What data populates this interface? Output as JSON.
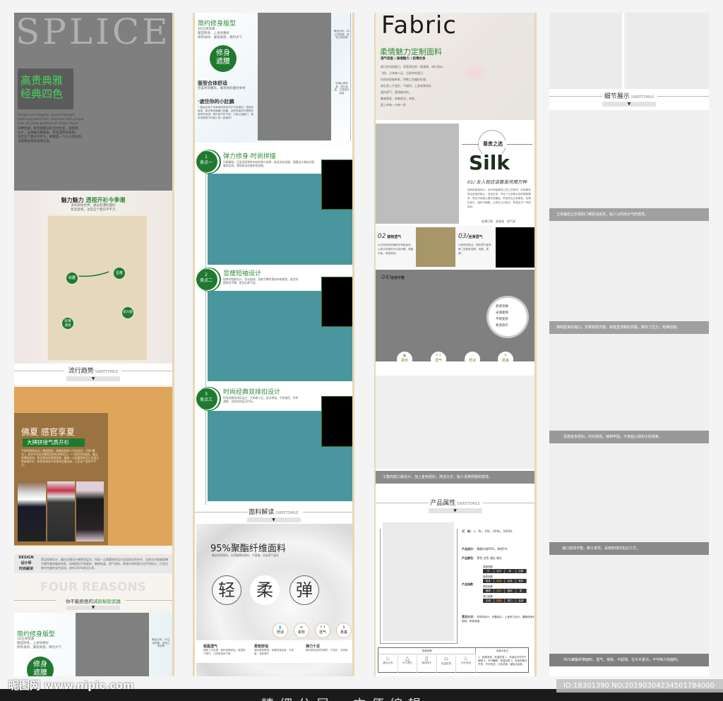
{
  "col1": {
    "splice": "SPLICE",
    "hero_title_1": "高贵典雅",
    "hero_title_2": "经典四色",
    "hero_en": "Simple and elegant, visual highlight charming waist line, decorate with proper size, all show goddess of urban charm",
    "hero_cn": [
      "四种色调，彰显着夏日的活力生机，透视感",
      "设计，呈现魅力腰部美，彰显成熟的美感。",
      "注定这个夏日不平凡，即使是一个小小的动作，",
      "也能看出她的美丽之处。"
    ],
    "charm_title_a": "魅力魅力",
    "charm_title_b": "透视开衫",
    "charm_title_c": "今季潮",
    "charm_sub": [
      "多彩缤纷世界，通过轻薄的面料",
      "彰显柔和，注定这个夏日不平凡"
    ],
    "badges": [
      "收腰",
      "显瘦",
      "遮大腿",
      "轻薄透视"
    ],
    "trend_title": "流行趋势",
    "sweetsmile": "SWEETSMILE",
    "summer_title": "佛夏 感官享夏",
    "summer_sub": "大牌拼接气质开衫",
    "summer_text": "今季时装周走出一袭透视装，随着轻松和人们的追求，不断“曝光”，成为今年夏季最受宠的时尚单品之一！四彩色的裙装，通过轻薄的面料，彰显柔和的透视效果，精选一点高腰线的设计呈夏日的轻柔外衫，彰显低调而不张扬的优雅品味，注定这个夏季不平凡。",
    "design_label": [
      "DESIGN",
      "设计师",
      "时尚解读"
    ],
    "design_text": "简洁短袖设计，露出优雅设计感更显层次，再加一点高腰线的设计呈现舒适的外衫，长款设计能够遮掩不够完美的腿部线条，高端面料手感柔软，触感轻盈、透气清凉，即使炎热的夏天也不用担心，打造出都市完美的女性身段，给你100%的回头率。",
    "four_reasons": "FOUR REASONS",
    "four_sub_a": "你不能拒绝的",
    "four_sub_b": "减龄秘密武器",
    "slim_title": "简约修身版型",
    "slim_text": [
      "3D立体剪裁",
      "版型修身，上身效果好",
      "修饰身材、展现质感，简约大气"
    ],
    "slim_badge": [
      "修身",
      "遮腰"
    ],
    "side_note": "黄金比例，3D立体剪裁，显现立体线条"
  },
  "col2": {
    "slim_title": "简约修身版型",
    "slim_text": [
      "3D立体剪裁",
      "版型修身，上身效果好",
      "修饰身材、展现质感，简约大气"
    ],
    "slim_badge": [
      "修身",
      "遮腰"
    ],
    "fit_title": "版型合体舒适",
    "fit_text": "完美修饰腰形，展现你的曼妙身材",
    "belly_title": "·遮住你的小肚腩",
    "belly_text": "一款适合每个年龄段的修身开衫不容错过！宽松的版型，能完美地隐藏小肚腩，这样的装扮可谓是非常有时尚感！简约而不失气质，又能凸显魅力，是你衣橱里不可缺少的一款服饰！",
    "side_notes": [
      "黄金比例，3D立体剪裁，显现立体线条",
      "协调比例修身，修长身姿，凸显曼妙身姿"
    ],
    "points": [
      {
        "num": "1",
        "label": "卖点一",
        "title": "弹力修身·时尚拼接",
        "text": "印刷精致，且采用高弹性布料的弹力效果，能显修身显瘦，高腰设计增加分割腰线比例，增强修身显瘦的视觉感。"
      },
      {
        "num": "2",
        "label": "卖点二",
        "title": "显瘦短袖设计",
        "text": "经典的短袖设计，优化肩线，剪裁手臂利落修饰感美观，遮住你肥胖的手臂，更显女神气质。"
      },
      {
        "num": "3",
        "label": "卖点三",
        "title": "时尚经典双排扣设计",
        "text": "时尚经典双排扣设计，立体感十足，层次感强，不易褪色，时尚减龄，活跃你的夏日时光。"
      }
    ],
    "fabric_title": "面料解读",
    "fabric_headline": "95%聚酯纤维面料",
    "fabric_sub": "精选优质面料，天然健康的面料，不易皱，吸湿透气极佳",
    "big_chars": [
      "轻",
      "柔",
      "弹"
    ],
    "icons": [
      "舒适",
      "柔软",
      "透气",
      "悬垂"
    ],
    "features": [
      {
        "title": "轻盈透气",
        "text": "精致工艺处理，面料轻柔舒适，吸湿排汗透气，让肌肤保持干爽"
      },
      {
        "title": "柔软舒适",
        "text": "面料柔软顺滑，穿着舒适贴身，不易皱，亲肤透气"
      },
      {
        "title": "弹力十足",
        "text": "面料具有良好的弹性，不变形，无拘束"
      }
    ]
  },
  "col3": {
    "fabric_word": "Fabric",
    "fabric_title": "柔情魅力定制面料",
    "fabric_tags": "透气轻盈 | 高端魅力 | 轻薄合身",
    "fabric_text": [
      "夏日的闷热夏日，享受清凉的一夏柔情，流行低纱，",
      "飞扬，立体感十足，活跃你的夏日，",
      "时尚的智能新款，特殊工艺编织处理，",
      "穿在身上不变形，不褪色，上身效果良好，",
      "面料透气，更清爽凉快，",
      "触感柔软，穿着舒适，亲肤，",
      "夏上的每一分每一秒"
    ],
    "noble_label": "尊贵之选",
    "silk_word": "Silk",
    "silk_subtitle": "01/ 女人就应该散发风情万种",
    "silk_text": "独特的版型设计，设计师独具匠心的工艺制作，时尚都体现出品质的贴心，多色可选，符合了大多数女性的搭配要求，再也不用担心撞衫的尴尬，彰显你自己的颜色，轻薄的设计，面料不粗糙，让你在炎炎夏日，彰显出不一样的色彩。",
    "checks": [
      "轻薄可视",
      "柔感强",
      "透气强"
    ],
    "p02_title": "02",
    "p02_label": "植物透气",
    "p02_text": "从天然绿色的植物中萃取染色，以免化学面料对污染问题，健康环保，享受舒适！",
    "p03_title": "03/",
    "p03_label": "丝滑透气",
    "p03_text": "与肌肤的贴合，柔软透气度有第二层肌肤感受，轻盈、柔顺！",
    "p04_title": "04/",
    "p04_label": "走线平整",
    "circle_items": [
      "舒适亲肤",
      "光滑柔和",
      "不易变形",
      "易洗快干"
    ],
    "icons": [
      "柔软",
      "透气",
      "舒适",
      "悬垂"
    ],
    "pocket_bar": "工整的假口袋设计，加上金色纽扣，简洁大方，给人清爽舒服的感觉。",
    "attr_title": "产品属性",
    "sweetsmile": "SWEETSMILE",
    "attrs": [
      {
        "k": "尺　码：",
        "v": "L、XL、XXL、XXXL、XXXXL"
      },
      {
        "k": "产品成分：",
        "v": "聚酯纤维95%，其他5%"
      },
      {
        "k": "产品颜色：",
        "v": "黑色 白色 酒红 粉红"
      },
      {
        "k": "产品指数",
        "v": ""
      },
      {
        "k": "宽设计点：",
        "v": "双排扣设计，折叠袖口，上身张力设计，腰部修身切割线，修身显瘦。"
      }
    ],
    "indexes": [
      {
        "name": "厚度指数",
        "opts": [
          "薄",
          "适中",
          "厚",
          "加厚"
        ],
        "sel": 0
      },
      {
        "name": "版型指数",
        "opts": [
          "紧身",
          "修身",
          "标准",
          "宽松"
        ],
        "sel": 1
      },
      {
        "name": "柔软指数",
        "opts": [
          "偏硬",
          "适中",
          "偏软",
          "柔"
        ],
        "sel": 1
      },
      {
        "name": "弹力指数",
        "opts": [
          "无弹",
          "微弹",
          "弹力",
          "高弹"
        ],
        "sel": 1
      }
    ],
    "wash_title": "洗涤说明",
    "wash_tip_title": "洗涤小贴士",
    "wash_icons": [
      "建议手洗",
      "不可漂白",
      "悬挂晾干",
      "低温熨烫",
      "分色洗涤"
    ],
    "wash_tips": "1、轻柔洗涤，低温熨烫 2、洗涤后不可拧干晾晒 3、不可曝晒，低温熨烫 4、深浅衣服分开洗，不可机洗，分色洗涤，避免沾染色"
  },
  "col4": {
    "detail_title": "细节展示",
    "sweetsmile": "SWEETSMILE",
    "bars": [
      "立体裁剪让衣领和门襟更加连贯，给人以时尚大气的感觉。",
      "堆积起来的袖口，非常有层次感，和笔直流畅的衣服，做出了区分，有律动感。",
      "百搭金色纽扣，时尚感强，缝制牢固，不用担心掉扣子的现象。",
      "袖口走线平整，做工考究，采用双线内包边工艺。",
      "95%聚酯纤维面料，透气、亲肤、不起球，在炎炎夏日，不可缺少的面料。"
    ]
  },
  "footer": {
    "logo": "昵图网",
    "url": "www.nipic.com",
    "id_text": "ID:18301390 NO:20190304234501784000",
    "bottom_caption": "精细分层，方便编辑"
  },
  "colors": {
    "green": "#2e8b3a",
    "teal": "#4a969f",
    "orange": "#dfa55a",
    "gray": "#808080"
  }
}
